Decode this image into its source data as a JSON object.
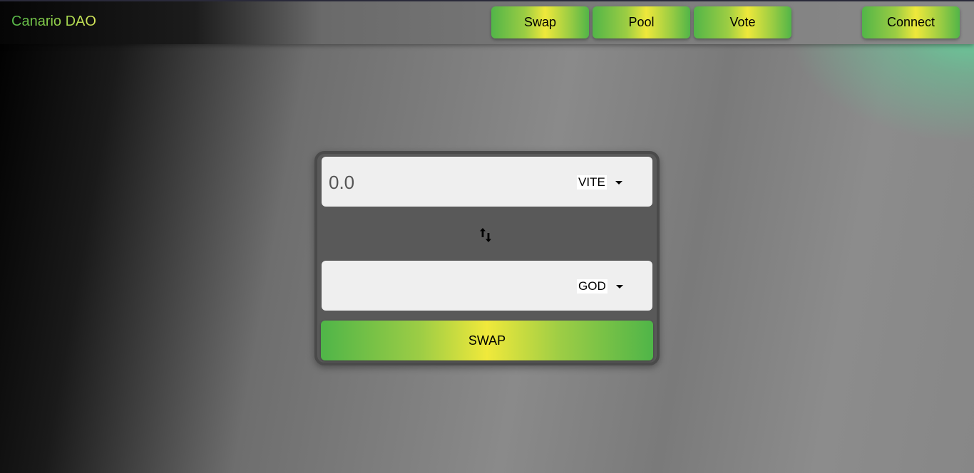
{
  "app": {
    "brand": "Canario DAO"
  },
  "nav": {
    "items": [
      {
        "label": "Swap"
      },
      {
        "label": "Pool"
      },
      {
        "label": "Vote"
      }
    ],
    "connect_label": "Connect"
  },
  "swap": {
    "from": {
      "placeholder": "0.0",
      "value": "",
      "token": "VITE"
    },
    "to": {
      "placeholder": "",
      "value": "",
      "token": "GOD"
    },
    "switch_icon": "swap-vertical-arrows-icon",
    "button_label": "SWAP"
  },
  "colors": {
    "accent_green": "#52b548",
    "accent_yellow": "#f0e93b",
    "card_bg": "#595959",
    "input_bg": "#efefef"
  }
}
